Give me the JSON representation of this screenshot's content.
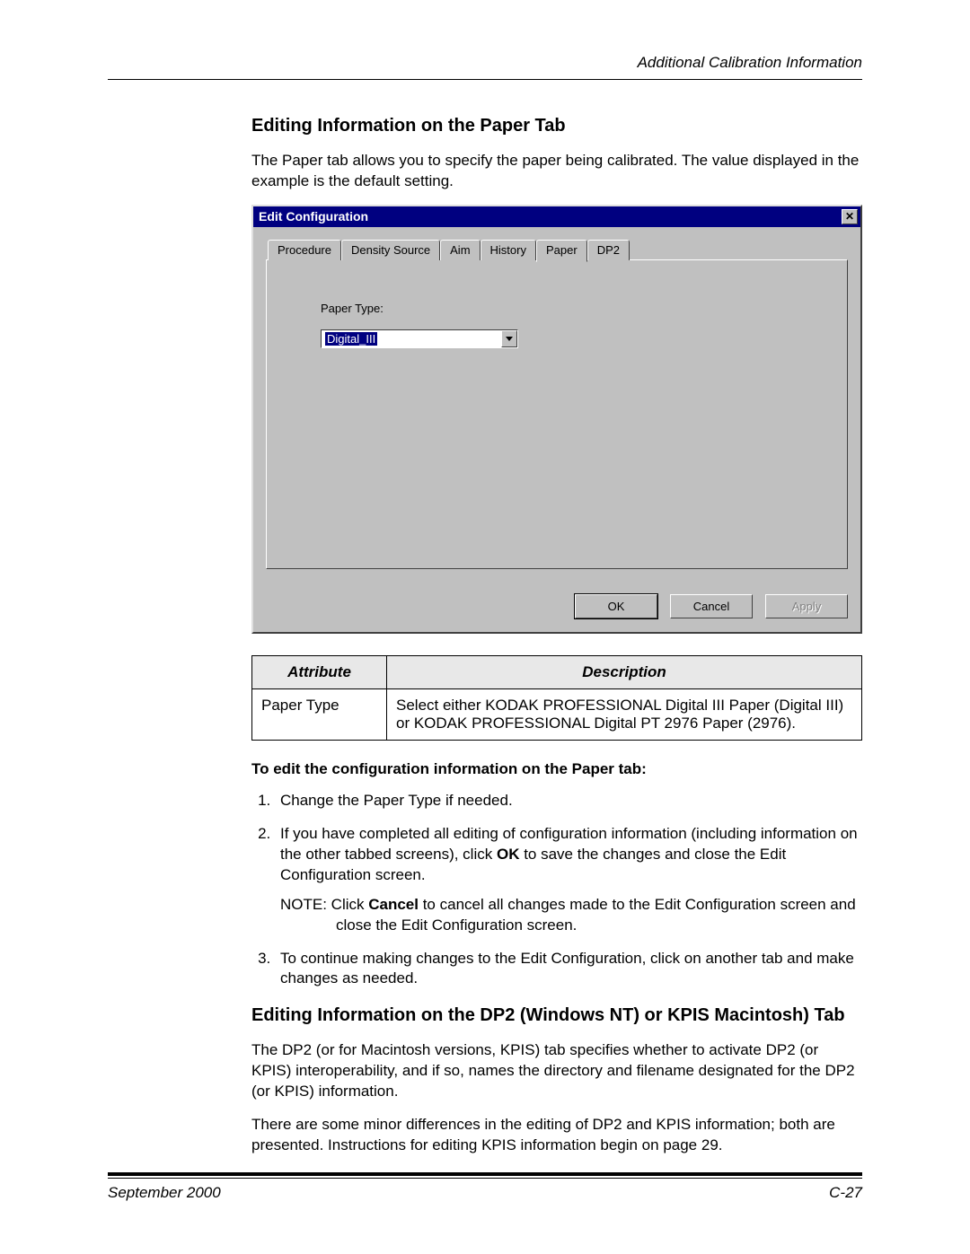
{
  "header": "Additional Calibration Information",
  "title1": "Editing Information on the Paper Tab",
  "intro1": "The Paper tab allows you to specify the paper being calibrated. The value displayed in the example is the default setting.",
  "dialog": {
    "title": "Edit Configuration",
    "tabs": [
      "Procedure",
      "Density Source",
      "Aim",
      "History",
      "Paper",
      "DP2"
    ],
    "activeTab": 4,
    "paperTypeLabel": "Paper Type:",
    "paperTypeValue": "Digital_III",
    "buttons": {
      "ok": "OK",
      "cancel": "Cancel",
      "apply": "Apply"
    }
  },
  "table": {
    "headAttr": "Attribute",
    "headDesc": "Description",
    "rows": [
      {
        "attr": "Paper Type",
        "desc": "Select either KODAK PROFESSIONAL Digital III Paper (Digital III) or KODAK PROFESSIONAL Digital PT 2976 Paper (2976)."
      }
    ]
  },
  "subhead": "To edit the configuration information on the Paper tab:",
  "steps": {
    "s1": "Change the Paper Type if needed.",
    "s2a": "If you have completed all editing of configuration information (including information on the other tabbed screens), click ",
    "s2b": "OK",
    "s2c": " to save the changes and close the Edit Configuration screen.",
    "noteA": "NOTE:  Click ",
    "noteB": "Cancel",
    "noteC": " to cancel all changes made to the Edit Configuration screen and close the Edit Configuration screen.",
    "s3": "To continue making changes to the Edit Configuration, click on another tab and make changes as needed."
  },
  "title2": "Editing Information on the DP2 (Windows NT) or KPIS Macintosh) Tab",
  "p2a": "The DP2 (or for Macintosh versions, KPIS) tab specifies whether to activate DP2 (or KPIS) interoperability, and if so, names the directory and filename designated for the DP2 (or KPIS) information.",
  "p2b": "There are some minor differences in the editing of DP2 and KPIS information; both are presented. Instructions for editing KPIS information begin on page 29.",
  "footer": {
    "left": "September 2000",
    "right": "C-27"
  }
}
